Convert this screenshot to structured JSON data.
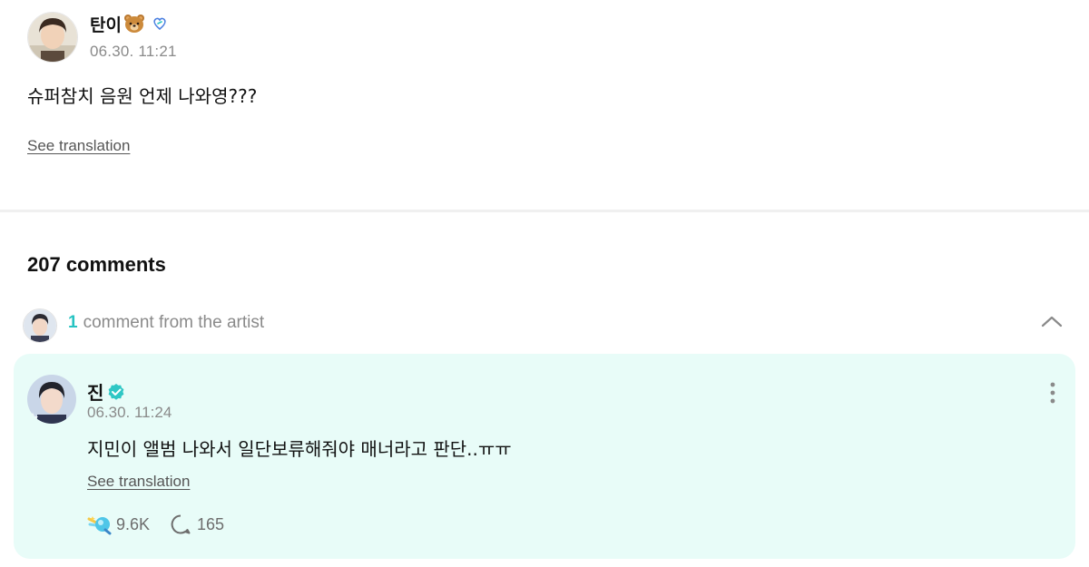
{
  "post": {
    "author": {
      "name": "탄이",
      "emoji": "🐻",
      "badge_icon": "fan-badge-icon"
    },
    "timestamp": "06.30. 11:21",
    "body": "슈퍼참치 음원 언제 나와영???",
    "see_translation": "See translation"
  },
  "comments": {
    "count_label": "207 comments",
    "artist_section": {
      "count": "1",
      "label": "comment from the artist",
      "toggle_icon": "chevron-up-icon"
    },
    "artist_comment": {
      "author": "진",
      "verified_icon": "verified-icon",
      "timestamp": "06.30. 11:24",
      "body": "지민이 앨범 나와서 일단보류해줘야 매너라고 판단..ㅠㅠ",
      "see_translation": "See translation",
      "likes": "9.6K",
      "replies": "165"
    }
  },
  "colors": {
    "accent": "#27c3c2",
    "card_background": "#e8fcf8",
    "muted_text": "#8a8a8a"
  }
}
